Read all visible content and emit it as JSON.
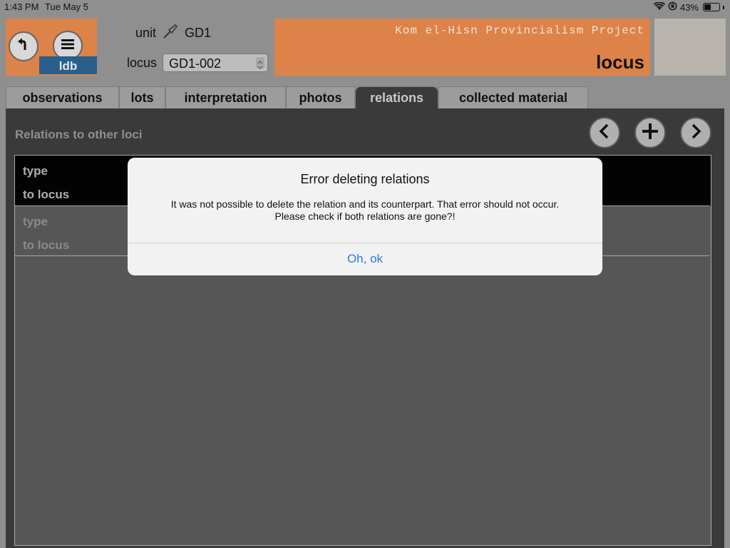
{
  "status_bar": {
    "time": "1:43 PM",
    "date": "Tue May 5",
    "battery": "43%",
    "battery_level": 0.43
  },
  "header": {
    "nav_tag": "ldb",
    "unit_label": "unit",
    "unit_value": "GD1",
    "locus_label": "locus",
    "locus_selected": "GD1-002",
    "project_title": "Kom el-Hisn Provincialism Project",
    "page_title": "locus"
  },
  "tabs": [
    {
      "label": "observations",
      "active": false
    },
    {
      "label": "lots",
      "active": false
    },
    {
      "label": "interpretation",
      "active": false
    },
    {
      "label": "photos",
      "active": false
    },
    {
      "label": "relations",
      "active": true
    },
    {
      "label": "collected material",
      "active": false
    }
  ],
  "relations": {
    "title": "Relations to other loci",
    "rows": [
      {
        "type_label": "type",
        "to_locus_label": "to locus"
      },
      {
        "type_label": "type",
        "to_locus_label": "to locus"
      }
    ]
  },
  "alert": {
    "title": "Error deleting relations",
    "message_line1": "It was not possible to delete the relation and its counterpart. That error should not occur.",
    "message_line2": "Please check if both relations are gone?!",
    "button": "Oh, ok"
  },
  "colors": {
    "header_orange": "#dd8248",
    "ldb_blue": "#2a5e8b",
    "link_blue": "#2f7ae5"
  }
}
